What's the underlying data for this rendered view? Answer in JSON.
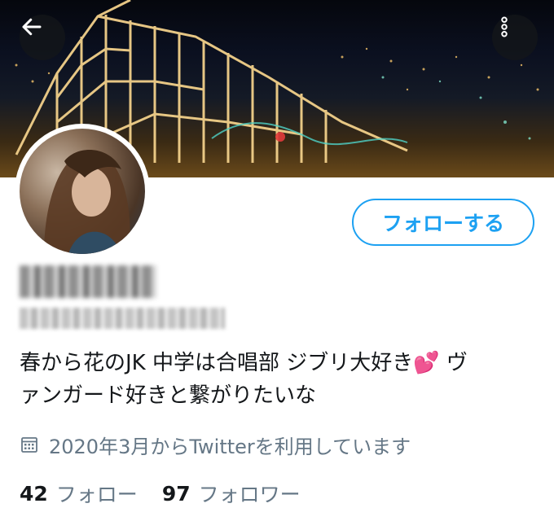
{
  "header": {
    "banner_image": "night-roller-coaster-banner",
    "back_icon": "back-arrow-icon",
    "more_icon": "more-vertical-icon"
  },
  "profile": {
    "avatar": "profile-avatar",
    "display_name": "",
    "handle": "",
    "follow_button_label": "フォローする",
    "bio_line1": "春から花のJK 中学は合唱部  ジブリ大好き",
    "bio_emoji": "💕",
    "bio_line1_tail": " ヴ",
    "bio_line2": "ァンガード好きと繋がりたいな",
    "joined_icon": "calendar-icon",
    "joined_text": "2020年3月からTwitterを利用しています",
    "following_count": "42",
    "following_label": "フォロー",
    "followers_count": "97",
    "followers_label": "フォロワー"
  },
  "colors": {
    "accent": "#1da1f2",
    "secondary_text": "#657786",
    "primary_text": "#14171a",
    "heart": "#e0245e"
  }
}
